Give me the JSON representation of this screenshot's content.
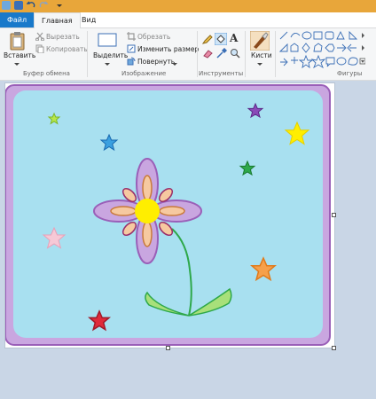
{
  "window": {
    "accent_color": "#e8a63a"
  },
  "quick_access": {
    "items": [
      "paint-app-icon",
      "save-icon",
      "undo-icon",
      "redo-icon",
      "customize-arrow-icon"
    ]
  },
  "tabs": {
    "file": "Файл",
    "home": "Главная",
    "view": "Вид"
  },
  "ribbon": {
    "clipboard": {
      "paste": "Вставить",
      "cut": "Вырезать",
      "copy": "Копировать",
      "label": "Буфер обмена"
    },
    "image": {
      "select": "Выделить",
      "crop": "Обрезать",
      "resize": "Изменить размер",
      "rotate": "Повернуть",
      "label": "Изображение"
    },
    "tools": {
      "label": "Инструменты"
    },
    "brushes": {
      "label": "Кисти"
    },
    "shapes": {
      "label": "Фигуры"
    }
  },
  "colors": {
    "tab_file_bg": "#1979ca",
    "canvas_background": "#a8e0f0",
    "frame": "#c9a6e0",
    "frame_border": "#9a5fb8",
    "petal": "#c9a6e0",
    "petal_inner": "#f6c9a0",
    "center": "#ffee00",
    "stem": "#2ea84a",
    "leaf": "#a8e07a"
  }
}
